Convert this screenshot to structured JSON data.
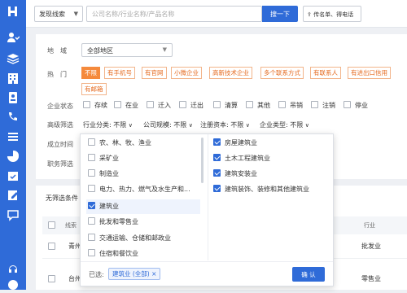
{
  "app": {
    "logo_text": ""
  },
  "sidebar": {
    "icons": [
      "users-icon",
      "stack-icon",
      "building-icon",
      "badge-icon",
      "phone-icon",
      "list-icon",
      "pie-chart-icon",
      "calendar-check-icon",
      "edit-icon",
      "chat-icon",
      "headset-icon",
      "support-icon"
    ]
  },
  "topbar": {
    "search_type": "发现线索",
    "search_placeholder": "公司名称/行业名称/产品名称",
    "search_button": "搜一下",
    "upload_button": "传名单、得电话"
  },
  "filters": {
    "region_label": "地　域",
    "region_value": "全部地区",
    "hot_label": "热　门",
    "hot_tags": [
      "不限",
      "有手机号",
      "有官网",
      "小微企业",
      "高新技术企业",
      "多个联系方式",
      "有联系人",
      "有进出口信用",
      "有邮箱"
    ],
    "status_label": "企业状态",
    "status_options": [
      "存续",
      "在业",
      "迁入",
      "迁出",
      "清算",
      "其他",
      "吊销",
      "注销",
      "停业"
    ],
    "advanced_label": "高级筛选",
    "advanced_filters": [
      "行业分类: 不限",
      "公司规模: 不限",
      "注册资本: 不限",
      "企业类型: 不限"
    ],
    "founded_label": "成立时间",
    "position_label": "职务筛选"
  },
  "results": {
    "header": "无筛选条件",
    "col_name": "线索",
    "col_industry": "行业",
    "rows": [
      {
        "name": "青州市",
        "industry": "批发业"
      },
      {
        "name": "台州市",
        "industry": "零售业"
      }
    ]
  },
  "industry_dropdown": {
    "left_options": [
      {
        "label": "农、林、牧、渔业",
        "checked": false
      },
      {
        "label": "采矿业",
        "checked": false
      },
      {
        "label": "制造业",
        "checked": false
      },
      {
        "label": "电力、热力、燃气及水生产和...",
        "checked": false
      },
      {
        "label": "建筑业",
        "checked": true
      },
      {
        "label": "批发和零售业",
        "checked": false
      },
      {
        "label": "交通运输、仓储和邮政业",
        "checked": false
      },
      {
        "label": "住宿和餐饮业",
        "checked": false
      }
    ],
    "right_options": [
      {
        "label": "房屋建筑业",
        "checked": true
      },
      {
        "label": "土木工程建筑业",
        "checked": true
      },
      {
        "label": "建筑安装业",
        "checked": true
      },
      {
        "label": "建筑装饰、装修和其他建筑业",
        "checked": true
      }
    ],
    "selected_label": "已选:",
    "selected_chip": "建筑业 (全部)",
    "chip_close": "×",
    "confirm_button": "确 认"
  },
  "colors": {
    "primary": "#2f6bd8",
    "accent_orange": "#f58a3c"
  }
}
